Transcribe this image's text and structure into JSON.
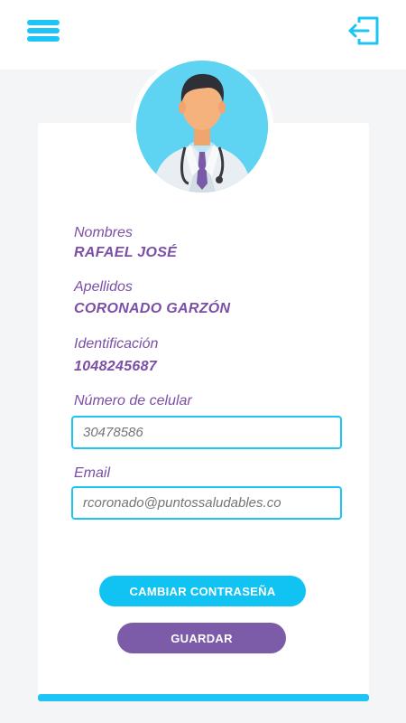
{
  "header": {
    "menu_icon": "hamburger-menu-icon",
    "logout_icon": "logout-icon",
    "accent_color": "#1ec4f4"
  },
  "profile": {
    "avatar": "doctor-avatar",
    "fields": {
      "nombres_label": "Nombres",
      "nombres_value": "RAFAEL JOSÉ",
      "apellidos_label": "Apellidos",
      "apellidos_value": "CORONADO GARZÓN",
      "identificacion_label": "Identificación",
      "identificacion_value": "1048245687",
      "celular_label": "Número de celular",
      "celular_placeholder": "30478586",
      "email_label": "Email",
      "email_placeholder": "rcoronado@puntossaludables.co"
    },
    "label_color": "#7b4fa6"
  },
  "actions": {
    "change_password_label": "CAMBIAR CONTRASEÑA",
    "save_label": "GUARDAR",
    "change_password_color": "#11c3f3",
    "save_color": "#7c5ca8"
  }
}
